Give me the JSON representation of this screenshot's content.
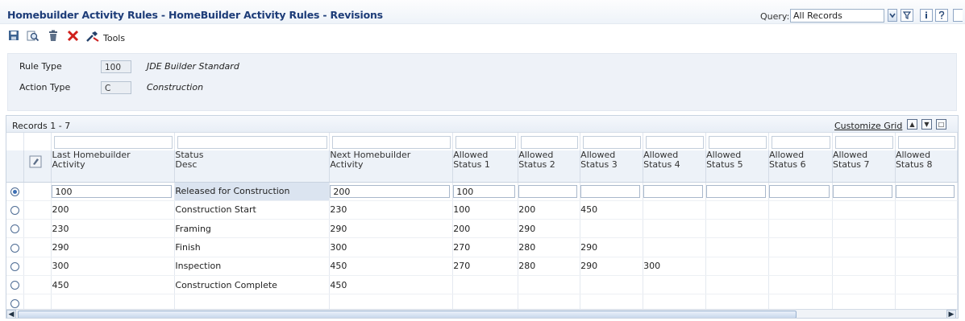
{
  "window": {
    "title": "Homebuilder Activity Rules - HomeBuilder Activity Rules - Revisions",
    "query_label": "Query:",
    "query_value": "All Records"
  },
  "toolbar": {
    "tools_label": "Tools"
  },
  "header": {
    "rule_type_label": "Rule Type",
    "rule_type_value": "100",
    "rule_type_desc": "JDE Builder Standard",
    "action_type_label": "Action Type",
    "action_type_value": "C",
    "action_type_desc": "Construction"
  },
  "grid": {
    "records_label": "Records 1 - 7",
    "customize_label": "Customize Grid",
    "columns": [
      {
        "line1": "Last Homebuilder",
        "line2": "Activity"
      },
      {
        "line1": "Status",
        "line2": "Desc"
      },
      {
        "line1": "Next Homebuilder",
        "line2": "Activity"
      },
      {
        "line1": "Allowed",
        "line2": "Status 1"
      },
      {
        "line1": "Allowed",
        "line2": "Status 2"
      },
      {
        "line1": "Allowed",
        "line2": "Status 3"
      },
      {
        "line1": "Allowed",
        "line2": "Status 4"
      },
      {
        "line1": "Allowed",
        "line2": "Status 5"
      },
      {
        "line1": "Allowed",
        "line2": "Status 6"
      },
      {
        "line1": "Allowed",
        "line2": "Status 7"
      },
      {
        "line1": "Allowed",
        "line2": "Status 8"
      }
    ],
    "rows": [
      {
        "selected": true,
        "cells": [
          "100",
          "Released for Construction",
          "200",
          "100",
          "",
          "",
          "",
          "",
          "",
          "",
          ""
        ]
      },
      {
        "selected": false,
        "cells": [
          "200",
          "Construction Start",
          "230",
          "100",
          "200",
          "450",
          "",
          "",
          "",
          "",
          ""
        ]
      },
      {
        "selected": false,
        "cells": [
          "230",
          "Framing",
          "290",
          "200",
          "290",
          "",
          "",
          "",
          "",
          "",
          ""
        ]
      },
      {
        "selected": false,
        "cells": [
          "290",
          "Finish",
          "300",
          "270",
          "280",
          "290",
          "",
          "",
          "",
          "",
          ""
        ]
      },
      {
        "selected": false,
        "cells": [
          "300",
          "Inspection",
          "450",
          "270",
          "280",
          "290",
          "300",
          "",
          "",
          "",
          ""
        ]
      },
      {
        "selected": false,
        "cells": [
          "450",
          "Construction Complete",
          "450",
          "",
          "",
          "",
          "",
          "",
          "",
          "",
          ""
        ]
      },
      {
        "selected": false,
        "cells": [
          "",
          "",
          "",
          "",
          "",
          "",
          "",
          "",
          "",
          "",
          ""
        ]
      }
    ]
  }
}
